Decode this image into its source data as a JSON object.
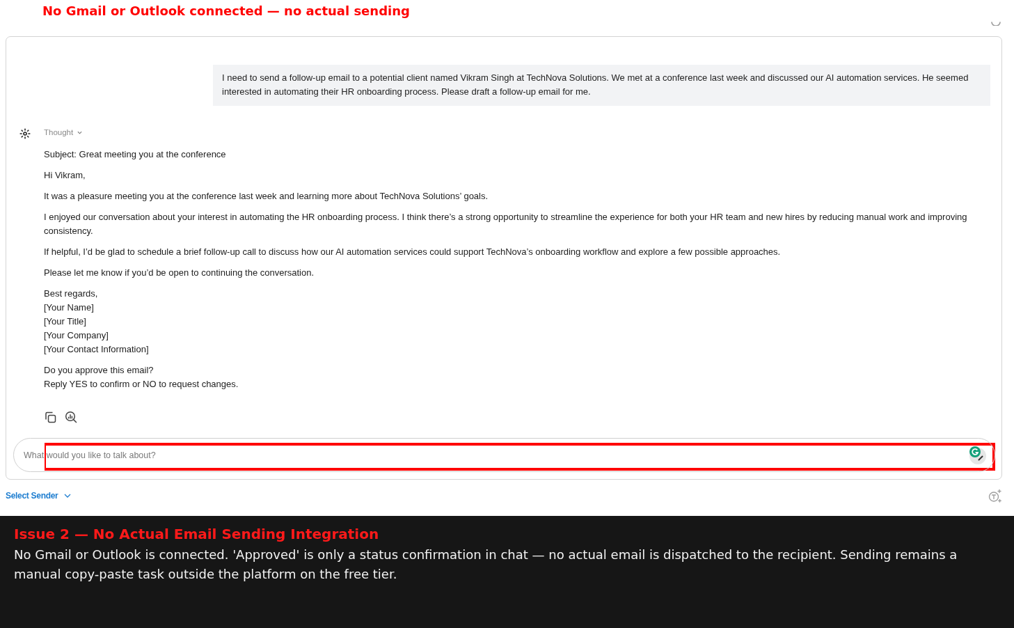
{
  "banner": {
    "text": "No Gmail or Outlook connected — no actual sending"
  },
  "chat": {
    "messages": [
      {
        "kind": "user",
        "text": "I need to send a follow-up email to a potential client named Vikram Singh at TechNova Solutions. We met at a conference last week and discussed our AI automation services. He seemed interested in automating their HR onboarding process. Please draft a follow-up email for me."
      },
      {
        "kind": "assistant",
        "thought_label": "Thought",
        "paragraphs": [
          [
            "Subject: Great meeting you at the conference"
          ],
          [
            "Hi Vikram,"
          ],
          [
            "It was a pleasure meeting you at the conference last week and learning more about TechNova Solutions’ goals."
          ],
          [
            "I enjoyed our conversation about your interest in automating the HR onboarding process. I think there’s a strong opportunity to streamline the experience for both your HR team and new hires by reducing manual work and improving consistency."
          ],
          [
            "If helpful, I’d be glad to schedule a brief follow-up call to discuss how our AI automation services could support TechNova’s onboarding workflow and explore a few possible approaches."
          ],
          [
            "Please let me know if you’d be open to continuing the conversation."
          ],
          [
            "Best regards,",
            "[Your Name]",
            "[Your Title]",
            "[Your Company]",
            "[Your Contact Information]"
          ],
          [
            "Do you approve this email?",
            "Reply YES to confirm or NO to request changes."
          ]
        ]
      }
    ]
  },
  "composer": {
    "placeholder": "What would you like to talk about?"
  },
  "sender_select": {
    "label": "Select Sender"
  },
  "callout": {
    "title": "Issue 2 — No Actual Email Sending Integration",
    "body": "No Gmail or Outlook is connected. 'Approved' is only a status confirmation in chat — no actual email is dispatched to the recipient. Sending remains a manual copy-paste task outside the platform on the free tier."
  }
}
